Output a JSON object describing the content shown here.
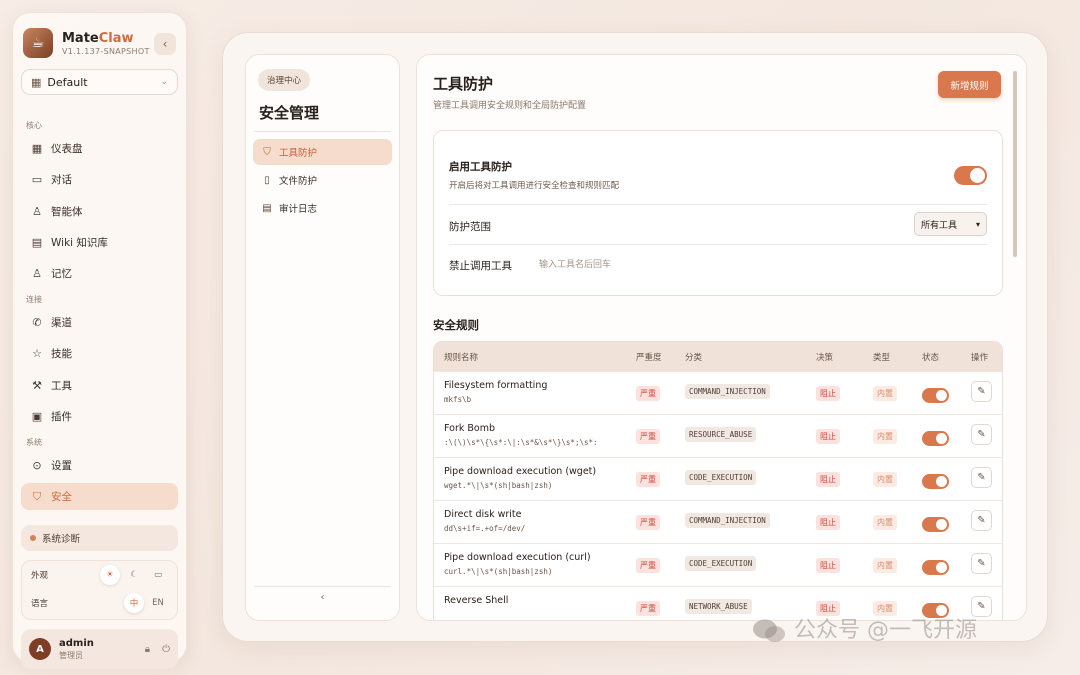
{
  "app": {
    "name_part1": "Mate",
    "name_part2": "Claw",
    "version": "V1.1.137-SNAPSHOT",
    "workspace": "Default"
  },
  "nav": {
    "group_core": "核心",
    "group_connect": "连接",
    "group_system": "系统",
    "items": [
      {
        "label": "仪表盘",
        "icon": "dashboard-icon"
      },
      {
        "label": "对话",
        "icon": "chat-icon"
      },
      {
        "label": "智能体",
        "icon": "agent-icon"
      },
      {
        "label": "Wiki 知识库",
        "icon": "book-icon"
      },
      {
        "label": "记忆",
        "icon": "memory-icon"
      },
      {
        "label": "渠道",
        "icon": "phone-icon"
      },
      {
        "label": "技能",
        "icon": "star-icon"
      },
      {
        "label": "工具",
        "icon": "wrench-icon"
      },
      {
        "label": "插件",
        "icon": "plugin-icon"
      },
      {
        "label": "设置",
        "icon": "settings-icon"
      },
      {
        "label": "安全",
        "icon": "shield-icon"
      }
    ]
  },
  "diagnostics": "系统诊断",
  "prefs": {
    "appearance_label": "外观",
    "language_label": "语言",
    "lang_zh": "中",
    "lang_en": "EN"
  },
  "user": {
    "initial": "A",
    "name": "admin",
    "role": "管理员"
  },
  "subnav": {
    "pill": "治理中心",
    "title": "安全管理",
    "items": [
      "工具防护",
      "文件防护",
      "审计日志"
    ]
  },
  "main": {
    "title": "工具防护",
    "subtitle": "管理工具调用安全规则和全局防护配置",
    "add_button": "新增规则",
    "enable_title": "启用工具防护",
    "enable_desc": "开启后将对工具调用进行安全检查和规则匹配",
    "enable_on": true,
    "scope_label": "防护范围",
    "scope_value": "所有工具",
    "block_label": "禁止调用工具",
    "block_placeholder": "输入工具名后回车",
    "rules_title": "安全规则"
  },
  "table": {
    "headers": [
      "规则名称",
      "严重度",
      "分类",
      "决策",
      "类型",
      "状态",
      "操作"
    ],
    "rows": [
      {
        "name": "Filesystem formatting",
        "pattern": "mkfs\\b",
        "severity": "严重",
        "category": "COMMAND_INJECTION",
        "decision": "阻止",
        "type": "内置",
        "enabled": true
      },
      {
        "name": "Fork Bomb",
        "pattern": ":\\(\\)\\s*\\{\\s*:\\|:\\s*&\\s*\\}\\s*;\\s*:",
        "severity": "严重",
        "category": "RESOURCE_ABUSE",
        "decision": "阻止",
        "type": "内置",
        "enabled": true
      },
      {
        "name": "Pipe download execution (wget)",
        "pattern": "wget.*\\|\\s*(sh|bash|zsh)",
        "severity": "严重",
        "category": "CODE_EXECUTION",
        "decision": "阻止",
        "type": "内置",
        "enabled": true
      },
      {
        "name": "Direct disk write",
        "pattern": "dd\\s+if=.+of=/dev/",
        "severity": "严重",
        "category": "COMMAND_INJECTION",
        "decision": "阻止",
        "type": "内置",
        "enabled": true
      },
      {
        "name": "Pipe download execution (curl)",
        "pattern": "curl.*\\|\\s*(sh|bash|zsh)",
        "severity": "严重",
        "category": "CODE_EXECUTION",
        "decision": "阻止",
        "type": "内置",
        "enabled": true
      },
      {
        "name": "Reverse Shell",
        "pattern": "",
        "severity": "严重",
        "category": "NETWORK_ABUSE",
        "decision": "阻止",
        "type": "内置",
        "enabled": true
      }
    ]
  },
  "watermark": "公众号 @一飞开源",
  "colors": {
    "accent": "#d9774d",
    "danger": "#d0493b"
  }
}
